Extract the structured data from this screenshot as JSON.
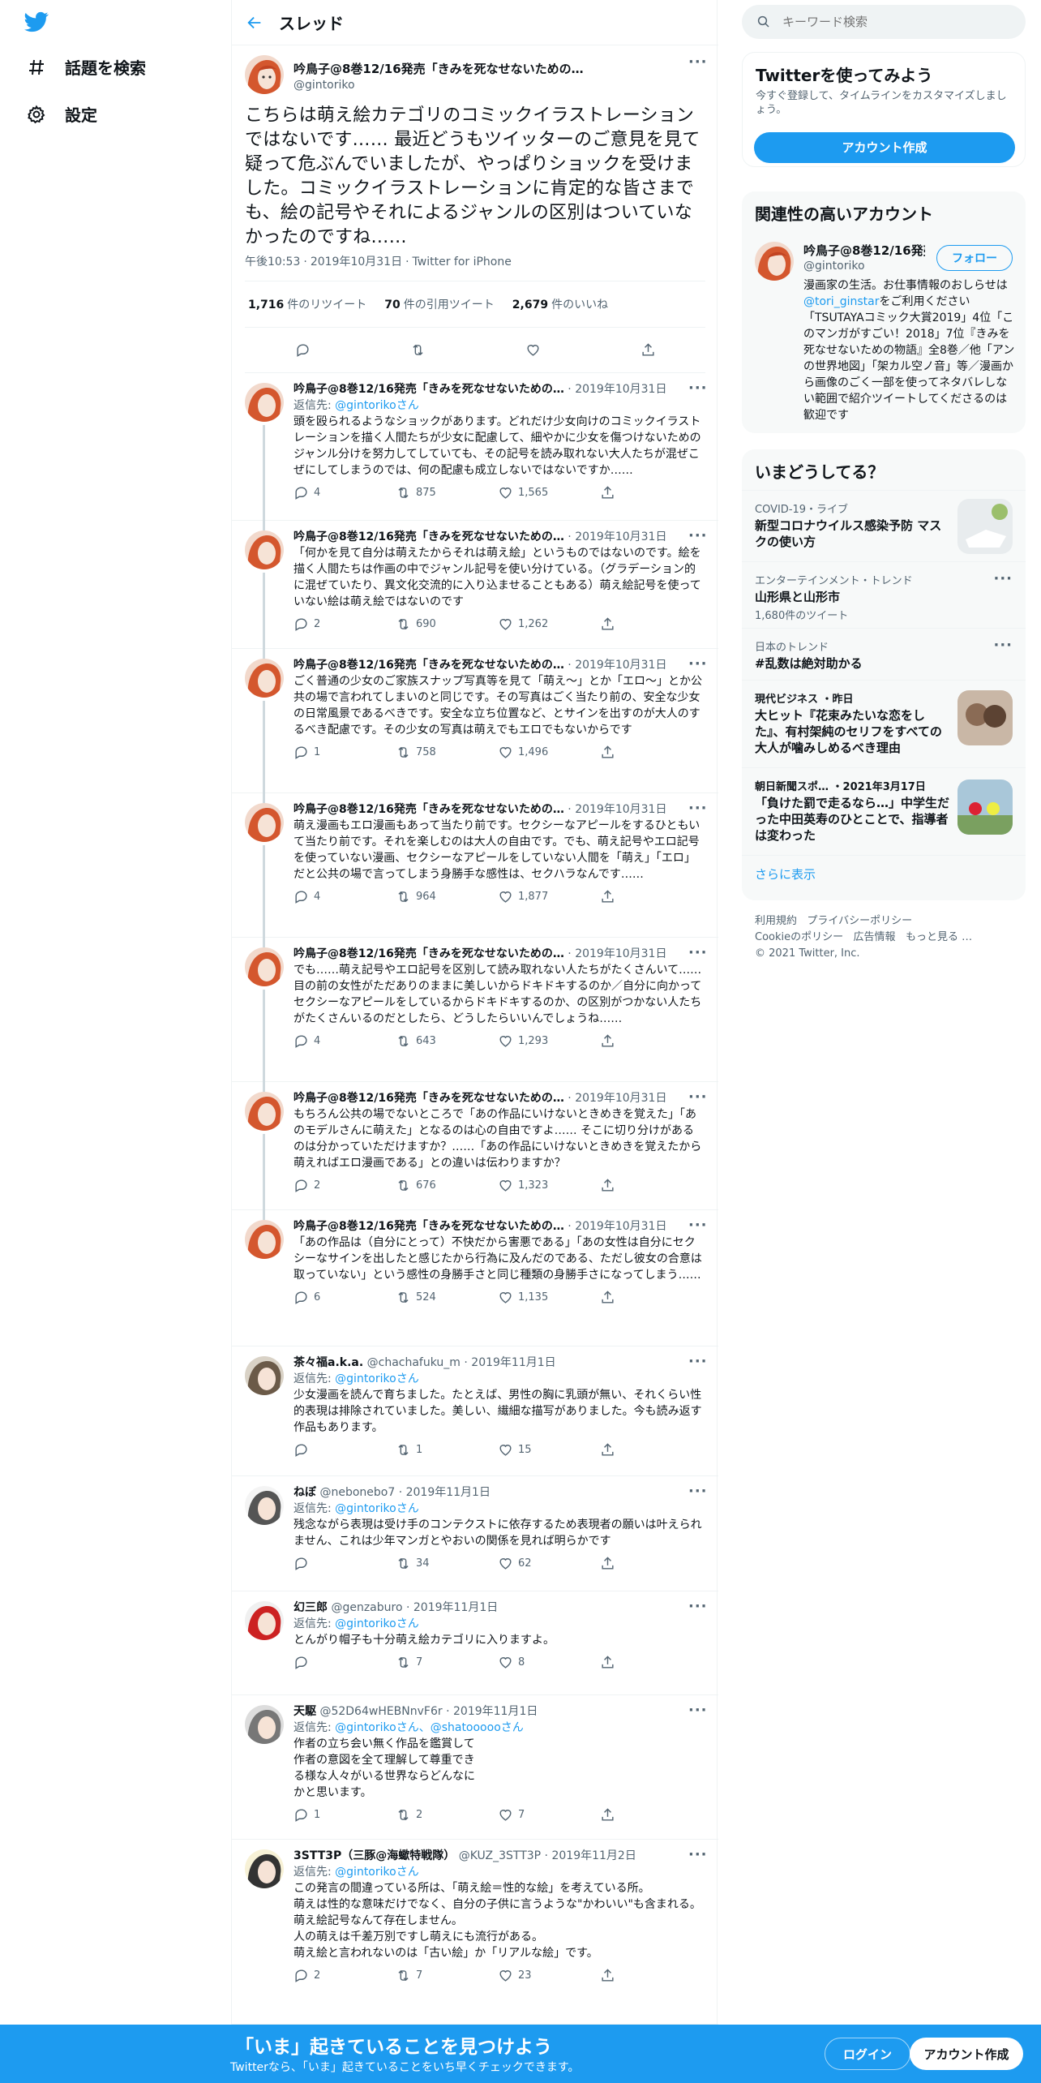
{
  "nav": {
    "explore_label": "話題を検索",
    "settings_label": "設定"
  },
  "header": {
    "title": "スレッド"
  },
  "main_tweet": {
    "name": "吟鳥子@8巻12/16発売「きみを死なせないための…",
    "handle": "@gintoriko",
    "text": "こちらは萌え絵カテゴリのコミックイラストレーションではないです…… 最近どうもツイッターのご意見を見て疑って危ぶんでいましたが、やっぱりショックを受けました。コミックイラストレーションに肯定的な皆さまでも、絵の記号やそれによるジャンルの区別はついていなかったのですね……",
    "time": "午後10:53",
    "date": "2019年10月31日",
    "client": "Twitter for iPhone",
    "retweets": "1,716",
    "retweets_label": "件のリツイート",
    "quotes": "70",
    "quotes_label": "件の引用ツイート",
    "likes": "2,679",
    "likes_label": "件のいいね"
  },
  "replies": [
    {
      "name": "吟鳥子@8巻12/16発売「きみを死なせないための…",
      "handle": "",
      "date": "2019年10月31日",
      "to_prefix": "返信先: ",
      "to": "@gintorikoさん",
      "text": "頭を殴られるようなショックがあります。どれだけ少女向けのコミックイラストレーションを描く人間たちが少女に配慮して、細やかに少女を傷つけないためのジャンル分けを努力してしていても、その記号を読み取れない大人たちが混ぜこぜにしてしまうのでは、何の配慮も成立しないではないですか……",
      "replies": "4",
      "retweets": "875",
      "likes": "1,565"
    },
    {
      "name": "吟鳥子@8巻12/16発売「きみを死なせないための…",
      "handle": "",
      "date": "2019年10月31日",
      "to_prefix": "",
      "to": "",
      "text": "「何かを見て自分は萌えたからそれは萌え絵」というものではないのです。絵を描く人間たちは作画の中でジャンル記号を使い分けている。（グラデーション的に混ぜていたり、異文化交流的に入り込ませることもある）萌え絵記号を使っていない絵は萌え絵ではないのです",
      "replies": "2",
      "retweets": "690",
      "likes": "1,262"
    },
    {
      "name": "吟鳥子@8巻12/16発売「きみを死なせないための…",
      "handle": "",
      "date": "2019年10月31日",
      "to_prefix": "",
      "to": "",
      "text": "ごく普通の少女のご家族スナップ写真等を見て「萌え〜」とか「エロ〜」とか公共の場で言われてしまいのと同じです。その写真はごく当たり前の、安全な少女の日常風景であるべきです。安全な立ち位置など、とサインを出すのが大人のするべき配慮です。その少女の写真は萌えでもエロでもないからです",
      "replies": "1",
      "retweets": "758",
      "likes": "1,496"
    },
    {
      "name": "吟鳥子@8巻12/16発売「きみを死なせないための…",
      "handle": "",
      "date": "2019年10月31日",
      "to_prefix": "",
      "to": "",
      "text": "萌え漫画もエロ漫画もあって当たり前です。セクシーなアピールをするひともいて当たり前です。それを楽しむのは大人の自由です。でも、萌え記号やエロ記号を使っていない漫画、セクシーなアピールをしていない人間を「萌え」「エロ」だと公共の場で言ってしまう身勝手な感性は、セクハラなんです……",
      "replies": "4",
      "retweets": "964",
      "likes": "1,877"
    },
    {
      "name": "吟鳥子@8巻12/16発売「きみを死なせないための…",
      "handle": "",
      "date": "2019年10月31日",
      "to_prefix": "",
      "to": "",
      "text": "でも……萌え記号やエロ記号を区別して読み取れない人たちがたくさんいて……目の前の女性がただありのままに美しいからドキドキするのか／自分に向かってセクシーなアピールをしているからドキドキするのか、の区別がつかない人たちがたくさんいるのだとしたら、どうしたらいいんでしょうね……",
      "replies": "4",
      "retweets": "643",
      "likes": "1,293"
    },
    {
      "name": "吟鳥子@8巻12/16発売「きみを死なせないための…",
      "handle": "",
      "date": "2019年10月31日",
      "to_prefix": "",
      "to": "",
      "text": "もちろん公共の場でないところで「あの作品にいけないときめきを覚えた」「あのモデルさんに萌えた」となるのは心の自由ですよ…… そこに切り分けがあるのは分かっていただけますか？……「あの作品にいけないときめきを覚えたから萌えればエロ漫画である」との違いは伝わりますか？",
      "replies": "2",
      "retweets": "676",
      "likes": "1,323"
    },
    {
      "name": "吟鳥子@8巻12/16発売「きみを死なせないための…",
      "handle": "",
      "date": "2019年10月31日",
      "to_prefix": "",
      "to": "",
      "text": "「あの作品は（自分にとって）不快だから害悪である」「あの女性は自分にセクシーなサインを出したと感じたから行為に及んだのである、ただし彼女の合意は取っていない」という感性の身勝手さと同じ種類の身勝手さになってしまう……",
      "replies": "6",
      "retweets": "524",
      "likes": "1,135"
    },
    {
      "name": "茶々福a.k.a.",
      "handle": "@chachafuku_m",
      "date": "2019年11月1日",
      "to_prefix": "返信先: ",
      "to": "@gintorikoさん",
      "text": "少女漫画を読んで育ちました。たとえば、男性の胸に乳頭が無い、それくらい性的表現は排除されていました。美しい、繊細な描写がありました。今も読み返す作品もあります。",
      "replies": "",
      "retweets": "1",
      "likes": "15"
    },
    {
      "name": "ねぼ",
      "handle": "@nebonebo7",
      "date": "2019年11月1日",
      "to_prefix": "返信先: ",
      "to": "@gintorikoさん",
      "text": "残念ながら表現は受け手のコンテクストに依存するため表現者の願いは叶えられません、これは少年マンガとやおいの関係を見れば明らかです",
      "replies": "",
      "retweets": "34",
      "likes": "62"
    },
    {
      "name": "幻三郎",
      "handle": "@genzaburo",
      "date": "2019年11月1日",
      "to_prefix": "返信先: ",
      "to": "@gintorikoさん",
      "text": "とんがり帽子も十分萌え絵カテゴリに入りますよ。",
      "replies": "",
      "retweets": "7",
      "likes": "8"
    },
    {
      "name": "天駆",
      "handle": "@52D64wHEBNnvF6r",
      "date": "2019年11月1日",
      "to_prefix": "返信先: ",
      "to": "@gintorikoさん、@shatoooooさん",
      "text": "作者の立ち会い無く作品を鑑賞して\n作者の意図を全て理解して尊重でき\nる様な人々がいる世界ならどんなに\nかと思います。",
      "replies": "1",
      "retweets": "2",
      "likes": "7"
    },
    {
      "name": "3STT3P（三豚@海蠍特戦隊）",
      "handle": "@KUZ_3STT3P",
      "date": "2019年11月2日",
      "to_prefix": "返信先: ",
      "to": "@gintorikoさん",
      "text": "この発言の間違っている所は、「萌え絵＝性的な絵」を考えている所。\n萌えは性的な意味だけでなく、自分の子供に言うような\"かわいい\"も含まれる。\n萌え絵記号なんて存在しません。\n人の萌えは千差万別ですし萌えにも流行がある。\n萌え絵と言われないのは「古い絵」か「リアルな絵」です。",
      "replies": "2",
      "retweets": "7",
      "likes": "23"
    }
  ],
  "search": {
    "placeholder": "キーワード検索"
  },
  "signup_card": {
    "title": "Twitterを使ってみよう",
    "sub": "今すぐ登録して、タイムラインをカスタマイズしましょう。",
    "button": "アカウント作成"
  },
  "related": {
    "title": "関連性の高いアカウント",
    "name": "吟鳥子@8巻12/16発売…",
    "handle": "@gintoriko",
    "follow": "フォロー",
    "bio_a": "漫画家の生活。お仕事情報のおしらせは",
    "bio_link": "@tori_ginstar",
    "bio_b": "をご利用ください「TSUTAYAコミック大賞2019」4位「このマンガがすごい！2018」7位『きみを死なせないための物語』全8巻／他「アンの世界地図」「架カル空ノ音」等／漫画から画像のごく一部を使ってネタバレしない範囲で紹介ツイートしてくださるのは歓迎です"
  },
  "trends": {
    "title": "いまどうしてる？",
    "items": [
      {
        "meta": "COVID-19・ライブ",
        "title": "新型コロナウイルス感染予防 マスクの使い方",
        "count": ""
      },
      {
        "meta": "エンターテインメント・トレンド",
        "title": "山形県と山形市",
        "count": "1,680件のツイート"
      },
      {
        "meta": "日本のトレンド",
        "title": "#乱数は絶対助かる",
        "count": ""
      },
      {
        "meta": "現代ビジネス ・昨日",
        "title": "大ヒット『花束みたいな恋をした』、有村架純のセリフをすべての大人が噛みしめるべき理由",
        "count": ""
      },
      {
        "meta": "朝日新聞スポ… ・2021年3月17日",
        "title": "「負けた罰で走るなら…」中学生だった中田英寿のひとことで、指導者は変わった",
        "count": ""
      }
    ],
    "show_more": "さらに表示"
  },
  "footer": {
    "links": [
      "利用規約",
      "プライバシーポリシー",
      "Cookieのポリシー",
      "広告情報",
      "もっと見る …"
    ],
    "copyright": "© 2021 Twitter, Inc."
  },
  "bottom": {
    "title": "「いま」起きていることを見つけよう",
    "sub": "Twitterなら、「いま」起きていることをいち早くチェックできます。",
    "login": "ログイン",
    "signup": "アカウント作成"
  },
  "colors": {
    "accent": "#1d9bf0",
    "text": "#0f1419",
    "muted": "#536471",
    "border": "#eff3f4",
    "card": "#f7f9f9"
  }
}
